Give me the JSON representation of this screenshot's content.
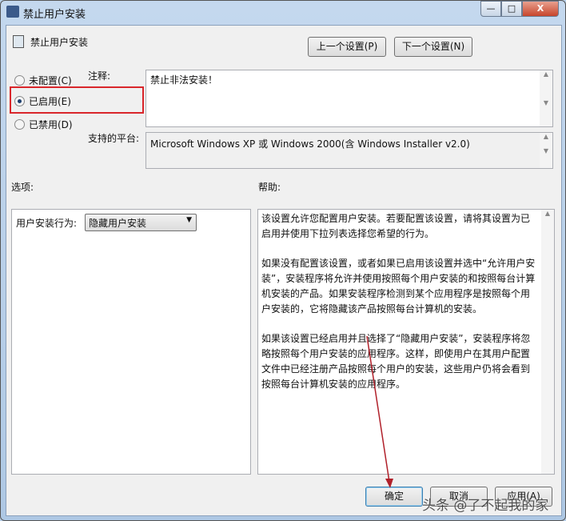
{
  "window": {
    "title": "禁止用户安装",
    "minimize": "—",
    "maximize": "□",
    "close": "X"
  },
  "header": {
    "policy_name": "禁止用户安装",
    "prev_button": "上一个设置(P)",
    "next_button": "下一个设置(N)"
  },
  "radios": [
    {
      "label": "未配置(C)",
      "checked": false
    },
    {
      "label": "已启用(E)",
      "checked": true
    },
    {
      "label": "已禁用(D)",
      "checked": false
    }
  ],
  "comment": {
    "label": "注释:",
    "value": "禁止非法安装！"
  },
  "platform": {
    "label": "支持的平台:",
    "value": "Microsoft Windows XP 或 Windows 2000(含 Windows Installer v2.0)"
  },
  "options": {
    "title": "选项:",
    "field_label": "用户安装行为:",
    "selected": "隐藏用户安装"
  },
  "help": {
    "title": "帮助:",
    "paragraphs": [
      "该设置允许您配置用户安装。若要配置该设置，请将其设置为已启用并使用下拉列表选择您希望的行为。",
      "如果没有配置该设置，或者如果已启用该设置并选中“允许用户安装”，安装程序将允许并使用按照每个用户安装的和按照每台计算机安装的产品。如果安装程序检测到某个应用程序是按照每个用户安装的，它将隐藏该产品按照每台计算机的安装。",
      "如果该设置已经启用并且选择了“隐藏用户安装”，安装程序将忽略按照每个用户安装的应用程序。这样，即使用户在其用户配置文件中已经注册产品按照每个用户的安装，这些用户仍将会看到按照每台计算机安装的应用程序。"
    ]
  },
  "footer": {
    "ok": "确定",
    "cancel": "取消",
    "apply": "应用(A)"
  },
  "watermark": "头条 @了不起我的家",
  "colors": {
    "highlight": "#d9262b",
    "arrow": "#b0202a"
  }
}
